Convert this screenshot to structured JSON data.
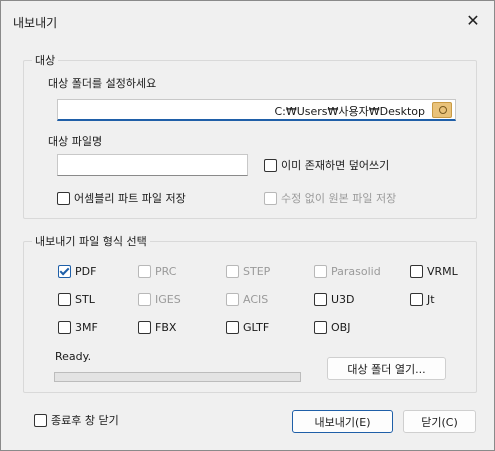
{
  "window": {
    "title": "내보내기",
    "close_glyph": "✕"
  },
  "target_group": {
    "title": "대상",
    "folder_label": "대상 폴더를 설정하세요",
    "folder_path": "C:₩Users₩사용자₩Desktop",
    "file_label": "대상 파일명",
    "file_value": "",
    "overwrite_label": "이미 존재하면 덮어쓰기",
    "overwrite_checked": false,
    "assembly_parts_label": "어셈블리 파트 파일 저장",
    "assembly_parts_checked": false,
    "save_original_label": "수정 없이 원본 파일 저장",
    "save_original_checked": false
  },
  "format_group": {
    "title": "내보내기 파일 형식 선택",
    "formats": [
      {
        "label": "PDF",
        "checked": true,
        "enabled": true
      },
      {
        "label": "PRC",
        "checked": false,
        "enabled": false
      },
      {
        "label": "STEP",
        "checked": false,
        "enabled": false
      },
      {
        "label": "Parasolid",
        "checked": false,
        "enabled": false
      },
      {
        "label": "VRML",
        "checked": false,
        "enabled": true
      },
      {
        "label": "STL",
        "checked": false,
        "enabled": true
      },
      {
        "label": "IGES",
        "checked": false,
        "enabled": false
      },
      {
        "label": "ACIS",
        "checked": false,
        "enabled": false
      },
      {
        "label": "U3D",
        "checked": false,
        "enabled": true
      },
      {
        "label": "Jt",
        "checked": false,
        "enabled": true
      },
      {
        "label": "3MF",
        "checked": false,
        "enabled": true
      },
      {
        "label": "FBX",
        "checked": false,
        "enabled": true
      },
      {
        "label": "GLTF",
        "checked": false,
        "enabled": true
      },
      {
        "label": "OBJ",
        "checked": false,
        "enabled": true
      }
    ],
    "status": "Ready.",
    "progress": 0,
    "open_folder_label": "대상 폴더 열기..."
  },
  "footer": {
    "close_after_label": "종료후 창 닫기",
    "close_after_checked": false,
    "export_label": "내보내기(E)",
    "close_label": "닫기(C)"
  },
  "icons": {
    "browse": "folder-search-icon",
    "close": "close-icon"
  },
  "colors": {
    "accent": "#1f5fa8",
    "progress": "#06b025",
    "background": "#f0f0f0"
  }
}
